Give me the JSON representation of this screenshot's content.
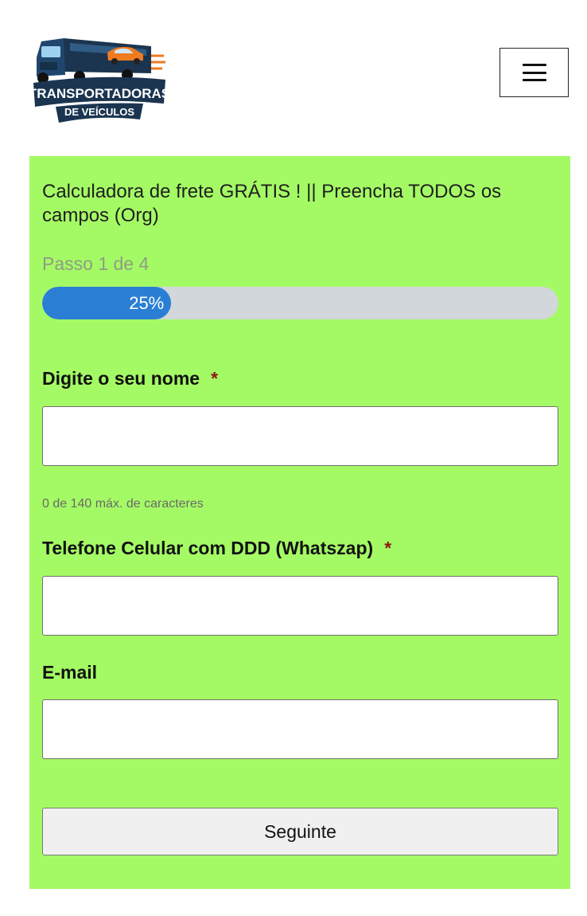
{
  "header": {
    "logo": {
      "line1": "TRANSPORTADORAS",
      "line2": "DE VEÍCULOS"
    },
    "menu_icon": "hamburger-icon"
  },
  "form": {
    "title": "Calculadora de frete GRÁTIS ! || Preencha TODOS os campos (Org)",
    "step_text": "Passo 1 de 4",
    "progress": {
      "percent": 25,
      "label": "25%"
    },
    "fields": [
      {
        "label": "Digite o seu nome",
        "required": "*",
        "value": "",
        "hint": "0 de 140 máx. de caracteres"
      },
      {
        "label": "Telefone Celular com DDD (Whatszap)",
        "required": "*",
        "value": ""
      },
      {
        "label": "E-mail",
        "value": ""
      }
    ],
    "next_label": "Seguinte"
  },
  "colors": {
    "form_background": "#a4fa64",
    "progress_fill": "#2a7fd4",
    "progress_track": "#d2d7db",
    "required_star": "#8a1a14",
    "logo_navy": "#1b3550",
    "logo_orange": "#f07a1e"
  }
}
